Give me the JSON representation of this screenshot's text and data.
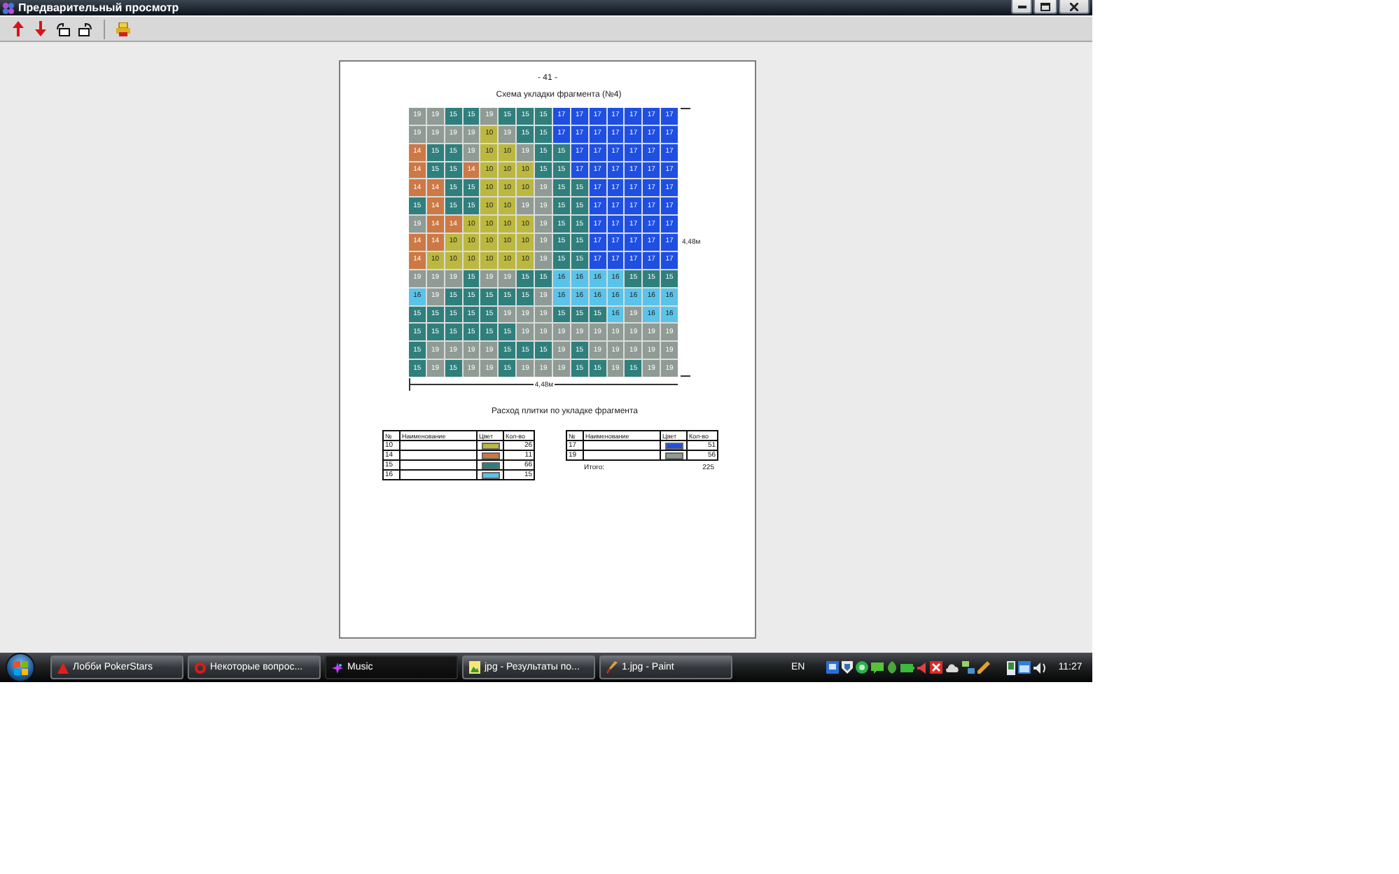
{
  "window": {
    "title": "Предварительный просмотр"
  },
  "page": {
    "header": "- 41 -",
    "title": "Схема укладки фрагмента (№4)",
    "side_dimension": "4,48м",
    "bottom_dimension": "4,48м",
    "grid": {
      "rows": [
        [
          {
            "text": "19",
            "color": "#8f9b94"
          },
          {
            "text": "19",
            "color": "#8f9b94"
          },
          {
            "text": "15",
            "color": "#2f7f7d"
          },
          {
            "text": "15",
            "color": "#2f7f7d"
          },
          {
            "text": "19",
            "color": "#8f9b94"
          },
          {
            "text": "15",
            "color": "#2f7f7d"
          },
          {
            "text": "15",
            "color": "#2f7f7d"
          },
          {
            "text": "15",
            "color": "#2f7f7d"
          },
          {
            "text": "17",
            "color": "#1f4fe2"
          },
          {
            "text": "17",
            "color": "#1f4fe2"
          },
          {
            "text": "17",
            "color": "#1f4fe2"
          },
          {
            "text": "17",
            "color": "#1f4fe2"
          },
          {
            "text": "17",
            "color": "#1f4fe2"
          },
          {
            "text": "17",
            "color": "#1f4fe2"
          },
          {
            "text": "17",
            "color": "#1f4fe2"
          }
        ],
        [
          {
            "text": "19",
            "color": "#8f9b94"
          },
          {
            "text": "19",
            "color": "#8f9b94"
          },
          {
            "text": "19",
            "color": "#8f9b94"
          },
          {
            "text": "19",
            "color": "#8f9b94"
          },
          {
            "text": "10",
            "color": "#bcb83f"
          },
          {
            "text": "19",
            "color": "#8f9b94"
          },
          {
            "text": "15",
            "color": "#2f7f7d"
          },
          {
            "text": "15",
            "color": "#2f7f7d"
          },
          {
            "text": "17",
            "color": "#1f4fe2"
          },
          {
            "text": "17",
            "color": "#1f4fe2"
          },
          {
            "text": "17",
            "color": "#1f4fe2"
          },
          {
            "text": "17",
            "color": "#1f4fe2"
          },
          {
            "text": "17",
            "color": "#1f4fe2"
          },
          {
            "text": "17",
            "color": "#1f4fe2"
          },
          {
            "text": "17",
            "color": "#1f4fe2"
          }
        ],
        [
          {
            "text": "14",
            "color": "#cd7945"
          },
          {
            "text": "15",
            "color": "#2f7f7d"
          },
          {
            "text": "15",
            "color": "#2f7f7d"
          },
          {
            "text": "19",
            "color": "#8f9b94"
          },
          {
            "text": "10",
            "color": "#bcb83f"
          },
          {
            "text": "10",
            "color": "#bcb83f"
          },
          {
            "text": "19",
            "color": "#8f9b94"
          },
          {
            "text": "15",
            "color": "#2f7f7d"
          },
          {
            "text": "15",
            "color": "#2f7f7d"
          },
          {
            "text": "17",
            "color": "#1f4fe2"
          },
          {
            "text": "17",
            "color": "#1f4fe2"
          },
          {
            "text": "17",
            "color": "#1f4fe2"
          },
          {
            "text": "17",
            "color": "#1f4fe2"
          },
          {
            "text": "17",
            "color": "#1f4fe2"
          },
          {
            "text": "17",
            "color": "#1f4fe2"
          }
        ],
        [
          {
            "text": "14",
            "color": "#cd7945"
          },
          {
            "text": "15",
            "color": "#2f7f7d"
          },
          {
            "text": "15",
            "color": "#2f7f7d"
          },
          {
            "text": "14",
            "color": "#cd7945"
          },
          {
            "text": "10",
            "color": "#bcb83f"
          },
          {
            "text": "10",
            "color": "#bcb83f"
          },
          {
            "text": "10",
            "color": "#bcb83f"
          },
          {
            "text": "15",
            "color": "#2f7f7d"
          },
          {
            "text": "15",
            "color": "#2f7f7d"
          },
          {
            "text": "17",
            "color": "#1f4fe2"
          },
          {
            "text": "17",
            "color": "#1f4fe2"
          },
          {
            "text": "17",
            "color": "#1f4fe2"
          },
          {
            "text": "17",
            "color": "#1f4fe2"
          },
          {
            "text": "17",
            "color": "#1f4fe2"
          },
          {
            "text": "17",
            "color": "#1f4fe2"
          }
        ],
        [
          {
            "text": "14",
            "color": "#cd7945"
          },
          {
            "text": "14",
            "color": "#cd7945"
          },
          {
            "text": "15",
            "color": "#2f7f7d"
          },
          {
            "text": "15",
            "color": "#2f7f7d"
          },
          {
            "text": "10",
            "color": "#bcb83f"
          },
          {
            "text": "10",
            "color": "#bcb83f"
          },
          {
            "text": "10",
            "color": "#bcb83f"
          },
          {
            "text": "19",
            "color": "#8f9b94"
          },
          {
            "text": "15",
            "color": "#2f7f7d"
          },
          {
            "text": "15",
            "color": "#2f7f7d"
          },
          {
            "text": "17",
            "color": "#1f4fe2"
          },
          {
            "text": "17",
            "color": "#1f4fe2"
          },
          {
            "text": "17",
            "color": "#1f4fe2"
          },
          {
            "text": "17",
            "color": "#1f4fe2"
          },
          {
            "text": "17",
            "color": "#1f4fe2"
          }
        ],
        [
          {
            "text": "15",
            "color": "#2f7f7d"
          },
          {
            "text": "14",
            "color": "#cd7945"
          },
          {
            "text": "15",
            "color": "#2f7f7d"
          },
          {
            "text": "15",
            "color": "#2f7f7d"
          },
          {
            "text": "10",
            "color": "#bcb83f"
          },
          {
            "text": "10",
            "color": "#bcb83f"
          },
          {
            "text": "19",
            "color": "#8f9b94"
          },
          {
            "text": "19",
            "color": "#8f9b94"
          },
          {
            "text": "15",
            "color": "#2f7f7d"
          },
          {
            "text": "15",
            "color": "#2f7f7d"
          },
          {
            "text": "17",
            "color": "#1f4fe2"
          },
          {
            "text": "17",
            "color": "#1f4fe2"
          },
          {
            "text": "17",
            "color": "#1f4fe2"
          },
          {
            "text": "17",
            "color": "#1f4fe2"
          },
          {
            "text": "17",
            "color": "#1f4fe2"
          }
        ],
        [
          {
            "text": "19",
            "color": "#8f9b94"
          },
          {
            "text": "14",
            "color": "#cd7945"
          },
          {
            "text": "14",
            "color": "#cd7945"
          },
          {
            "text": "10",
            "color": "#bcb83f"
          },
          {
            "text": "10",
            "color": "#bcb83f"
          },
          {
            "text": "10",
            "color": "#bcb83f"
          },
          {
            "text": "10",
            "color": "#bcb83f"
          },
          {
            "text": "19",
            "color": "#8f9b94"
          },
          {
            "text": "15",
            "color": "#2f7f7d"
          },
          {
            "text": "15",
            "color": "#2f7f7d"
          },
          {
            "text": "17",
            "color": "#1f4fe2"
          },
          {
            "text": "17",
            "color": "#1f4fe2"
          },
          {
            "text": "17",
            "color": "#1f4fe2"
          },
          {
            "text": "17",
            "color": "#1f4fe2"
          },
          {
            "text": "17",
            "color": "#1f4fe2"
          }
        ],
        [
          {
            "text": "14",
            "color": "#cd7945"
          },
          {
            "text": "14",
            "color": "#cd7945"
          },
          {
            "text": "10",
            "color": "#bcb83f"
          },
          {
            "text": "10",
            "color": "#bcb83f"
          },
          {
            "text": "10",
            "color": "#bcb83f"
          },
          {
            "text": "10",
            "color": "#bcb83f"
          },
          {
            "text": "10",
            "color": "#bcb83f"
          },
          {
            "text": "19",
            "color": "#8f9b94"
          },
          {
            "text": "15",
            "color": "#2f7f7d"
          },
          {
            "text": "15",
            "color": "#2f7f7d"
          },
          {
            "text": "17",
            "color": "#1f4fe2"
          },
          {
            "text": "17",
            "color": "#1f4fe2"
          },
          {
            "text": "17",
            "color": "#1f4fe2"
          },
          {
            "text": "17",
            "color": "#1f4fe2"
          },
          {
            "text": "17",
            "color": "#1f4fe2"
          }
        ],
        [
          {
            "text": "14",
            "color": "#cd7945"
          },
          {
            "text": "10",
            "color": "#bcb83f"
          },
          {
            "text": "10",
            "color": "#bcb83f"
          },
          {
            "text": "10",
            "color": "#bcb83f"
          },
          {
            "text": "10",
            "color": "#bcb83f"
          },
          {
            "text": "10",
            "color": "#bcb83f"
          },
          {
            "text": "10",
            "color": "#bcb83f"
          },
          {
            "text": "19",
            "color": "#8f9b94"
          },
          {
            "text": "15",
            "color": "#2f7f7d"
          },
          {
            "text": "15",
            "color": "#2f7f7d"
          },
          {
            "text": "17",
            "color": "#1f4fe2"
          },
          {
            "text": "17",
            "color": "#1f4fe2"
          },
          {
            "text": "17",
            "color": "#1f4fe2"
          },
          {
            "text": "17",
            "color": "#1f4fe2"
          },
          {
            "text": "17",
            "color": "#1f4fe2"
          }
        ],
        [
          {
            "text": "19",
            "color": "#8f9b94"
          },
          {
            "text": "19",
            "color": "#8f9b94"
          },
          {
            "text": "19",
            "color": "#8f9b94"
          },
          {
            "text": "15",
            "color": "#2f7f7d"
          },
          {
            "text": "19",
            "color": "#8f9b94"
          },
          {
            "text": "19",
            "color": "#8f9b94"
          },
          {
            "text": "15",
            "color": "#2f7f7d"
          },
          {
            "text": "15",
            "color": "#2f7f7d"
          },
          {
            "text": "16",
            "color": "#5ac3ea"
          },
          {
            "text": "16",
            "color": "#5ac3ea"
          },
          {
            "text": "16",
            "color": "#5ac3ea"
          },
          {
            "text": "16",
            "color": "#5ac3ea"
          },
          {
            "text": "15",
            "color": "#2f7f7d"
          },
          {
            "text": "15",
            "color": "#2f7f7d"
          },
          {
            "text": "15",
            "color": "#2f7f7d"
          }
        ],
        [
          {
            "text": "16",
            "color": "#5ac3ea"
          },
          {
            "text": "19",
            "color": "#8f9b94"
          },
          {
            "text": "15",
            "color": "#2f7f7d"
          },
          {
            "text": "15",
            "color": "#2f7f7d"
          },
          {
            "text": "15",
            "color": "#2f7f7d"
          },
          {
            "text": "15",
            "color": "#2f7f7d"
          },
          {
            "text": "15",
            "color": "#2f7f7d"
          },
          {
            "text": "19",
            "color": "#8f9b94"
          },
          {
            "text": "16",
            "color": "#5ac3ea"
          },
          {
            "text": "16",
            "color": "#5ac3ea"
          },
          {
            "text": "16",
            "color": "#5ac3ea"
          },
          {
            "text": "16",
            "color": "#5ac3ea"
          },
          {
            "text": "16",
            "color": "#5ac3ea"
          },
          {
            "text": "16",
            "color": "#5ac3ea"
          },
          {
            "text": "16",
            "color": "#5ac3ea"
          }
        ],
        [
          {
            "text": "15",
            "color": "#2f7f7d"
          },
          {
            "text": "15",
            "color": "#2f7f7d"
          },
          {
            "text": "15",
            "color": "#2f7f7d"
          },
          {
            "text": "15",
            "color": "#2f7f7d"
          },
          {
            "text": "15",
            "color": "#2f7f7d"
          },
          {
            "text": "19",
            "color": "#8f9b94"
          },
          {
            "text": "19",
            "color": "#8f9b94"
          },
          {
            "text": "19",
            "color": "#8f9b94"
          },
          {
            "text": "15",
            "color": "#2f7f7d"
          },
          {
            "text": "15",
            "color": "#2f7f7d"
          },
          {
            "text": "15",
            "color": "#2f7f7d"
          },
          {
            "text": "16",
            "color": "#5ac3ea"
          },
          {
            "text": "19",
            "color": "#8f9b94"
          },
          {
            "text": "16",
            "color": "#5ac3ea"
          },
          {
            "text": "16",
            "color": "#5ac3ea"
          }
        ],
        [
          {
            "text": "15",
            "color": "#2f7f7d"
          },
          {
            "text": "15",
            "color": "#2f7f7d"
          },
          {
            "text": "15",
            "color": "#2f7f7d"
          },
          {
            "text": "15",
            "color": "#2f7f7d"
          },
          {
            "text": "15",
            "color": "#2f7f7d"
          },
          {
            "text": "15",
            "color": "#2f7f7d"
          },
          {
            "text": "19",
            "color": "#8f9b94"
          },
          {
            "text": "19",
            "color": "#8f9b94"
          },
          {
            "text": "19",
            "color": "#8f9b94"
          },
          {
            "text": "19",
            "color": "#8f9b94"
          },
          {
            "text": "19",
            "color": "#8f9b94"
          },
          {
            "text": "19",
            "color": "#8f9b94"
          },
          {
            "text": "19",
            "color": "#8f9b94"
          },
          {
            "text": "19",
            "color": "#8f9b94"
          },
          {
            "text": "19",
            "color": "#8f9b94"
          }
        ],
        [
          {
            "text": "15",
            "color": "#2f7f7d"
          },
          {
            "text": "19",
            "color": "#8f9b94"
          },
          {
            "text": "19",
            "color": "#8f9b94"
          },
          {
            "text": "19",
            "color": "#8f9b94"
          },
          {
            "text": "19",
            "color": "#8f9b94"
          },
          {
            "text": "15",
            "color": "#2f7f7d"
          },
          {
            "text": "15",
            "color": "#2f7f7d"
          },
          {
            "text": "15",
            "color": "#2f7f7d"
          },
          {
            "text": "19",
            "color": "#8f9b94"
          },
          {
            "text": "15",
            "color": "#2f7f7d"
          },
          {
            "text": "19",
            "color": "#8f9b94"
          },
          {
            "text": "19",
            "color": "#8f9b94"
          },
          {
            "text": "19",
            "color": "#8f9b94"
          },
          {
            "text": "19",
            "color": "#8f9b94"
          },
          {
            "text": "19",
            "color": "#8f9b94"
          }
        ],
        [
          {
            "text": "15",
            "color": "#2f7f7d"
          },
          {
            "text": "19",
            "color": "#8f9b94"
          },
          {
            "text": "15",
            "color": "#2f7f7d"
          },
          {
            "text": "19",
            "color": "#8f9b94"
          },
          {
            "text": "19",
            "color": "#8f9b94"
          },
          {
            "text": "15",
            "color": "#2f7f7d"
          },
          {
            "text": "19",
            "color": "#8f9b94"
          },
          {
            "text": "19",
            "color": "#8f9b94"
          },
          {
            "text": "19",
            "color": "#8f9b94"
          },
          {
            "text": "15",
            "color": "#2f7f7d"
          },
          {
            "text": "15",
            "color": "#2f7f7d"
          },
          {
            "text": "19",
            "color": "#8f9b94"
          },
          {
            "text": "15",
            "color": "#2f7f7d"
          },
          {
            "text": "19",
            "color": "#8f9b94"
          },
          {
            "text": "19",
            "color": "#8f9b94"
          }
        ]
      ]
    }
  },
  "legend": {
    "title": "Расход плитки по укладке фрагмента",
    "tables": [
      {
        "columns": [
          "№",
          "Наименование",
          "Цвет",
          "Кол-во"
        ],
        "rows": [
          {
            "code": "10",
            "color": "#bcb83f",
            "count": "26"
          },
          {
            "code": "14",
            "color": "#cd7945",
            "count": "11"
          },
          {
            "code": "15",
            "color": "#2f7f7d",
            "count": "66"
          },
          {
            "code": "16",
            "color": "#5ac3ea",
            "count": "15"
          }
        ]
      },
      {
        "columns": [
          "№",
          "Наименование",
          "Цвет",
          "Кол-во"
        ],
        "rows": [
          {
            "code": "17",
            "color": "#1f4fe2",
            "count": "51"
          },
          {
            "code": "19",
            "color": "#8f9b94",
            "count": "56"
          }
        ],
        "total": {
          "label": "Итого:",
          "value": "225"
        }
      }
    ]
  },
  "taskbar": {
    "tasks": [
      {
        "label": "Лобби PokerStars",
        "selected": false
      },
      {
        "label": "Некоторые вопрос...",
        "selected": false
      },
      {
        "label": "Music",
        "selected": true
      },
      {
        "label": "jpg - Результаты по...",
        "selected": false
      },
      {
        "label": "1.jpg - Paint",
        "selected": false
      }
    ],
    "language": "EN",
    "clock": "11:27"
  }
}
